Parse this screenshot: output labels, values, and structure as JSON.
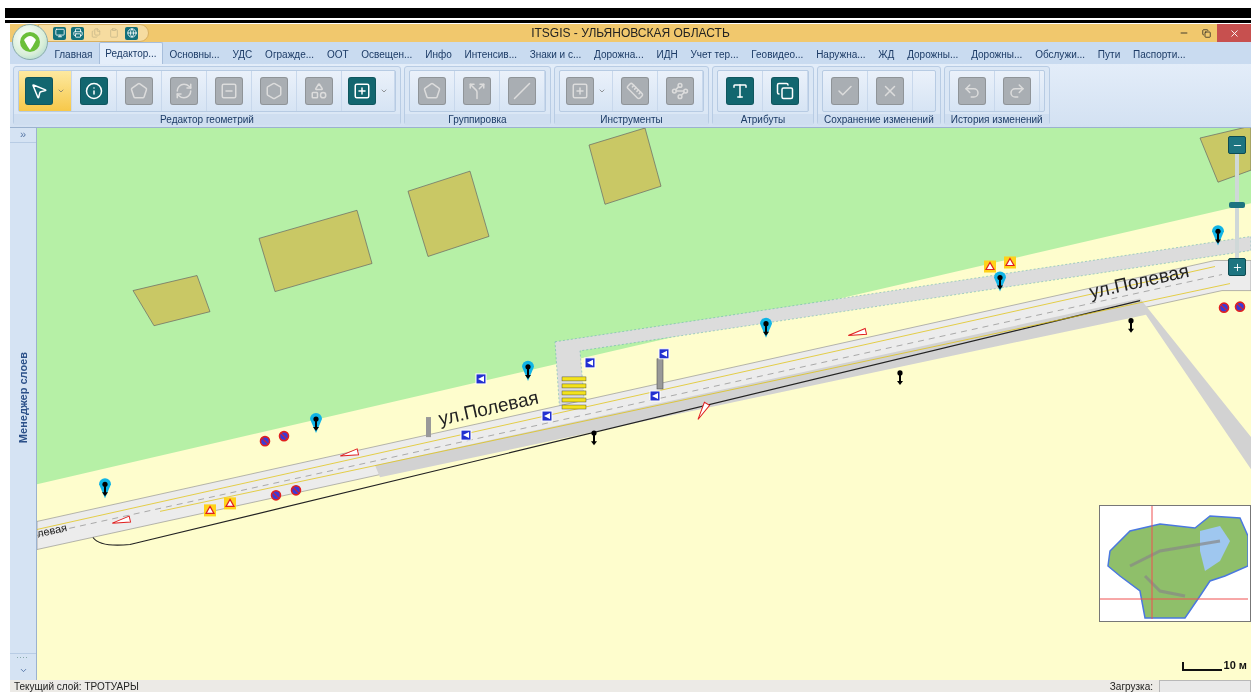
{
  "window": {
    "title": "ITSGIS - УЛЬЯНОВСКАЯ ОБЛАСТЬ"
  },
  "quick_access": [
    {
      "disabled": false
    },
    {
      "disabled": false
    },
    {
      "disabled": true
    },
    {
      "disabled": true
    },
    {
      "disabled": false
    }
  ],
  "tabs": [
    {
      "label": "Главная",
      "selected": false
    },
    {
      "label": "Редактор...",
      "selected": true
    },
    {
      "label": "Основны...",
      "selected": false
    },
    {
      "label": "УДС",
      "selected": false
    },
    {
      "label": "Огражде...",
      "selected": false
    },
    {
      "label": "ООТ",
      "selected": false
    },
    {
      "label": "Освещен...",
      "selected": false
    },
    {
      "label": "Инфо",
      "selected": false
    },
    {
      "label": "Интенсив...",
      "selected": false
    },
    {
      "label": "Знаки и с...",
      "selected": false
    },
    {
      "label": "Дорожна...",
      "selected": false
    },
    {
      "label": "ИДН",
      "selected": false
    },
    {
      "label": "Учет тер...",
      "selected": false
    },
    {
      "label": "Геовидео...",
      "selected": false
    },
    {
      "label": "Наружна...",
      "selected": false
    },
    {
      "label": "ЖД",
      "selected": false
    },
    {
      "label": "Дорожны...",
      "selected": false
    },
    {
      "label": "Дорожны...",
      "selected": false
    },
    {
      "label": "Обслужи...",
      "selected": false
    },
    {
      "label": "Пути",
      "selected": false
    },
    {
      "label": "Паспорти...",
      "selected": false
    }
  ],
  "ribbon_groups": [
    {
      "label": "Редактор геометрий",
      "tools": [
        {
          "disabled": false,
          "selected": true,
          "dropdown": true
        },
        {
          "disabled": false,
          "selected": false,
          "dropdown": false
        },
        {
          "disabled": true,
          "selected": false,
          "dropdown": false
        },
        {
          "disabled": true,
          "selected": false,
          "dropdown": false
        },
        {
          "disabled": true,
          "selected": false,
          "dropdown": false
        },
        {
          "disabled": true,
          "selected": false,
          "dropdown": false
        },
        {
          "disabled": true,
          "selected": false,
          "dropdown": false
        },
        {
          "disabled": false,
          "selected": false,
          "dropdown": true
        }
      ]
    },
    {
      "label": "Группировка",
      "tools": [
        {
          "disabled": true,
          "selected": false,
          "dropdown": false
        },
        {
          "disabled": true,
          "selected": false,
          "dropdown": false
        },
        {
          "disabled": true,
          "selected": false,
          "dropdown": false
        }
      ]
    },
    {
      "label": "Инструменты",
      "tools": [
        {
          "disabled": true,
          "selected": false,
          "dropdown": true
        },
        {
          "disabled": true,
          "selected": false,
          "dropdown": false
        },
        {
          "disabled": true,
          "selected": false,
          "dropdown": false
        }
      ]
    },
    {
      "label": "Атрибуты",
      "tools": [
        {
          "disabled": false,
          "selected": false,
          "dropdown": false
        },
        {
          "disabled": false,
          "selected": false,
          "dropdown": false
        }
      ]
    },
    {
      "label": "Сохранение изменений",
      "tools": [
        {
          "disabled": true,
          "selected": false,
          "dropdown": false
        },
        {
          "disabled": true,
          "selected": false,
          "dropdown": false
        }
      ]
    },
    {
      "label": "История изменений",
      "tools": [
        {
          "disabled": true,
          "selected": false,
          "dropdown": false
        },
        {
          "disabled": true,
          "selected": false,
          "dropdown": false
        }
      ]
    }
  ],
  "side_panel": {
    "expand": "»",
    "title": "Менеджер слоев"
  },
  "map": {
    "street_labels": [
      "ул.Полевая",
      "ул.Полевая",
      "левая"
    ],
    "zoom": {
      "level": 0.51
    },
    "scale": "10 м"
  },
  "status_bar": {
    "layer": "Текущий слой: ТРОТУАРЫ",
    "loading_label": "Загрузка:",
    "loading": {
      "level": 0
    }
  }
}
